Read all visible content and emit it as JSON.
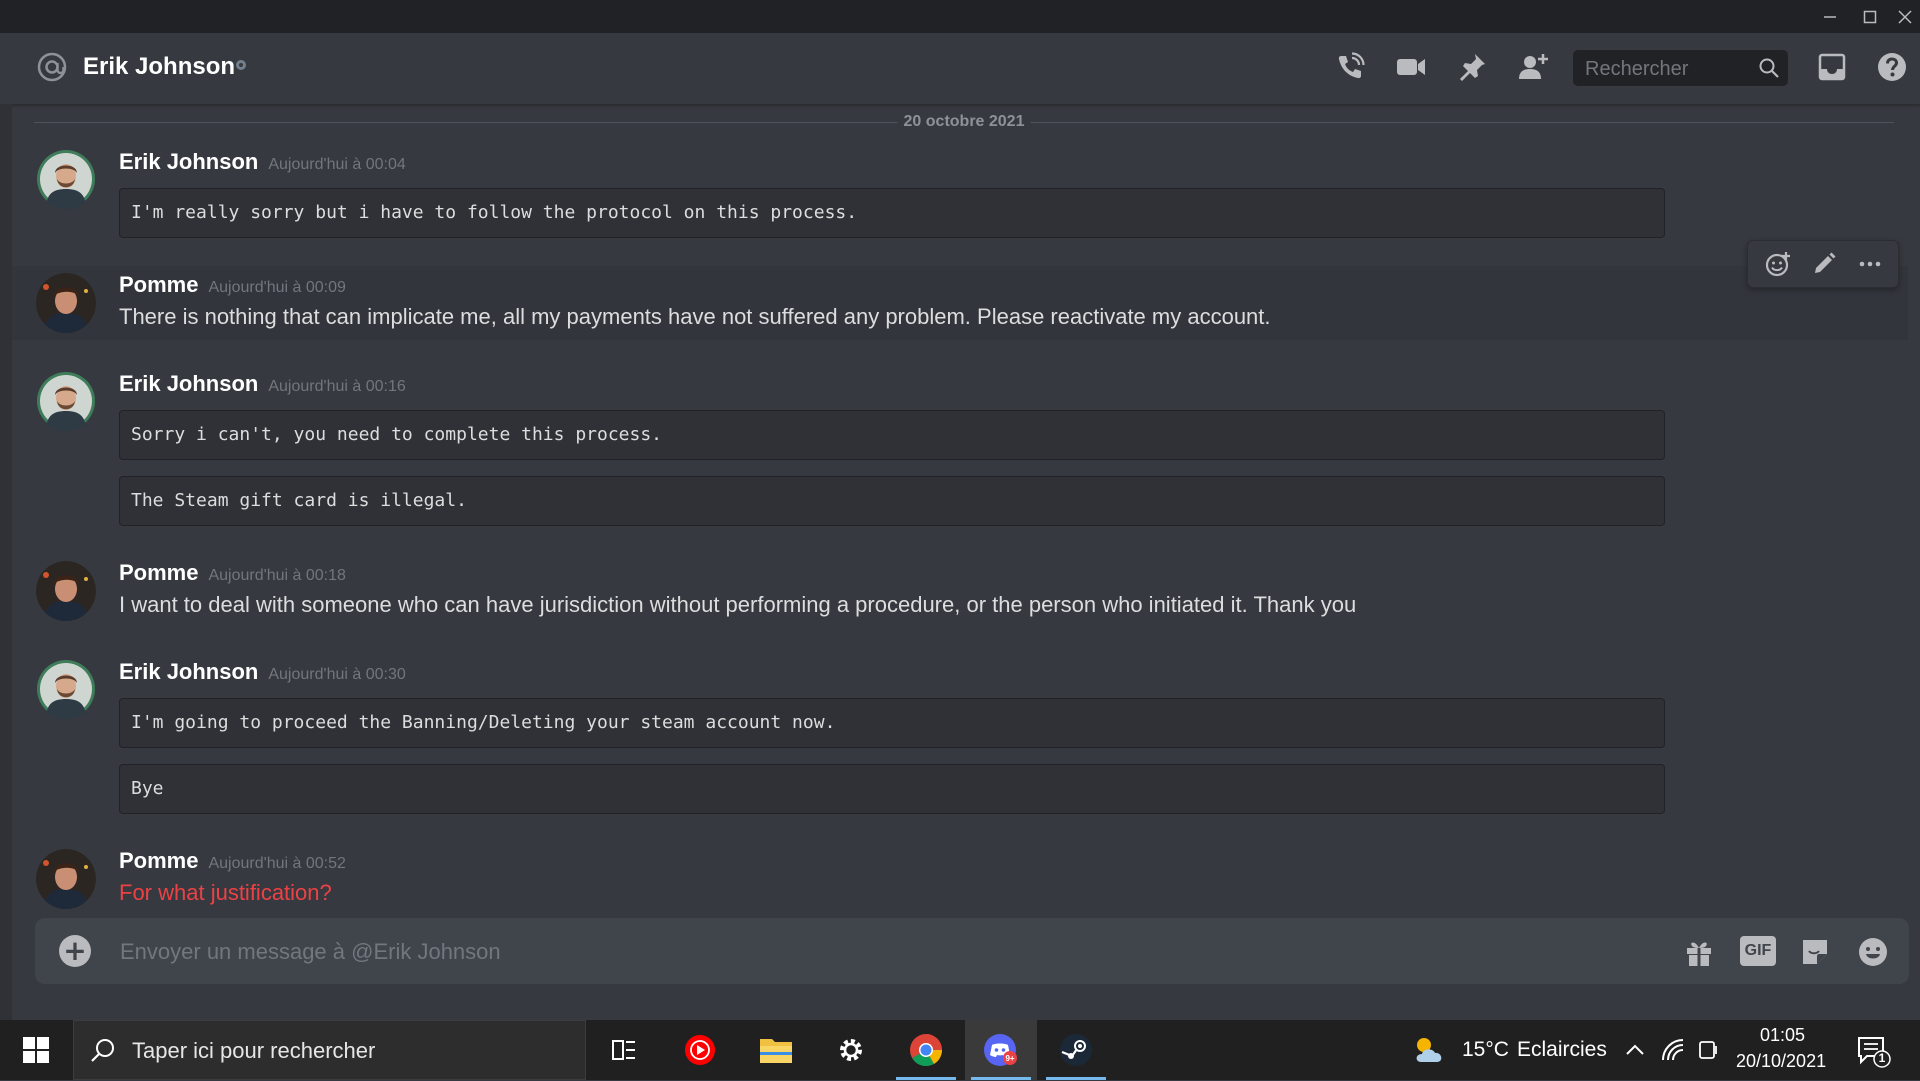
{
  "window": {
    "minimize_icon": "minimize-icon",
    "maximize_icon": "maximize-icon",
    "close_icon": "close-icon"
  },
  "header": {
    "channel_icon": "at-icon",
    "title": "Erik Johnson",
    "status": "offline",
    "actions": [
      "start-voice-call-icon",
      "start-video-call-icon",
      "pinned-messages-icon",
      "add-friend-icon"
    ],
    "search_placeholder": "Rechercher",
    "inbox_icon": "inbox-icon",
    "help_icon": "help-icon"
  },
  "date_divider": "20 octobre 2021",
  "messages": [
    {
      "author": "Erik Johnson",
      "timestamp": "Aujourd'hui à 00:04",
      "codeblocks": [
        "I'm really sorry but i have to follow the protocol on this process."
      ]
    },
    {
      "author": "Pomme",
      "timestamp": "Aujourd'hui à 00:09",
      "text": "There is nothing that can implicate me, all my payments have not suffered any problem. Please reactivate my account."
    },
    {
      "author": "Erik Johnson",
      "timestamp": "Aujourd'hui à 00:16",
      "codeblocks": [
        "Sorry i can't, you need to complete this process.",
        "The Steam gift card is illegal."
      ]
    },
    {
      "author": "Pomme",
      "timestamp": "Aujourd'hui à 00:18",
      "text": "I want to deal with someone who can have jurisdiction without performing a procedure, or the person who initiated it. Thank you"
    },
    {
      "author": "Erik Johnson",
      "timestamp": "Aujourd'hui à 00:30",
      "codeblocks": [
        "I'm going to proceed the Banning/Deleting your steam account now.",
        "Bye"
      ]
    },
    {
      "author": "Pomme",
      "timestamp": "Aujourd'hui à 00:52",
      "text": "For what justification?"
    }
  ],
  "message_toolbar": [
    "add-reaction-icon",
    "edit-icon",
    "more-icon"
  ],
  "composer": {
    "placeholder": "Envoyer un message à @Erik Johnson",
    "gif_label": "GIF",
    "icons": [
      "add-attachment-icon",
      "gift-icon",
      "sticker-icon",
      "emoji-icon"
    ]
  },
  "taskbar": {
    "search_placeholder": "Taper ici pour rechercher",
    "apps": [
      "task-view-icon",
      "youtube-music-icon",
      "file-explorer-icon",
      "settings-icon",
      "chrome-icon",
      "discord-icon",
      "steam-icon"
    ],
    "discord_badge": "9+",
    "weather": {
      "temp": "15°C",
      "condition": "Eclaircies"
    },
    "time": "01:05",
    "date": "20/10/2021",
    "notification_count": "1"
  },
  "colors": {
    "background": "#36393f",
    "title_bar": "#202225",
    "accent_red": "#ed4245",
    "taskbar": "#202020",
    "status_offline": "#747f8d"
  }
}
